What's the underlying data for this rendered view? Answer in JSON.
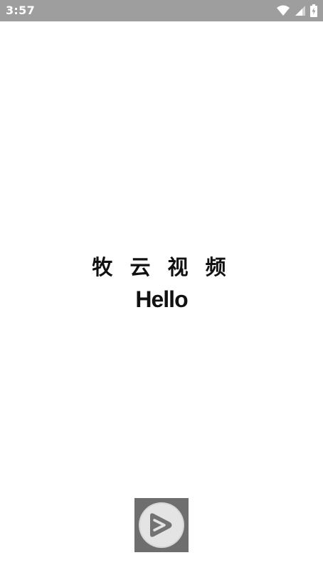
{
  "status_bar": {
    "time": "3:57",
    "icons": [
      "wifi-icon",
      "cell-signal-icon",
      "battery-charging-icon"
    ],
    "background": "#9e9e9e"
  },
  "splash": {
    "title": "牧 云 视 频",
    "subtitle": "Hello",
    "logo_icon": "play-logo-icon"
  }
}
